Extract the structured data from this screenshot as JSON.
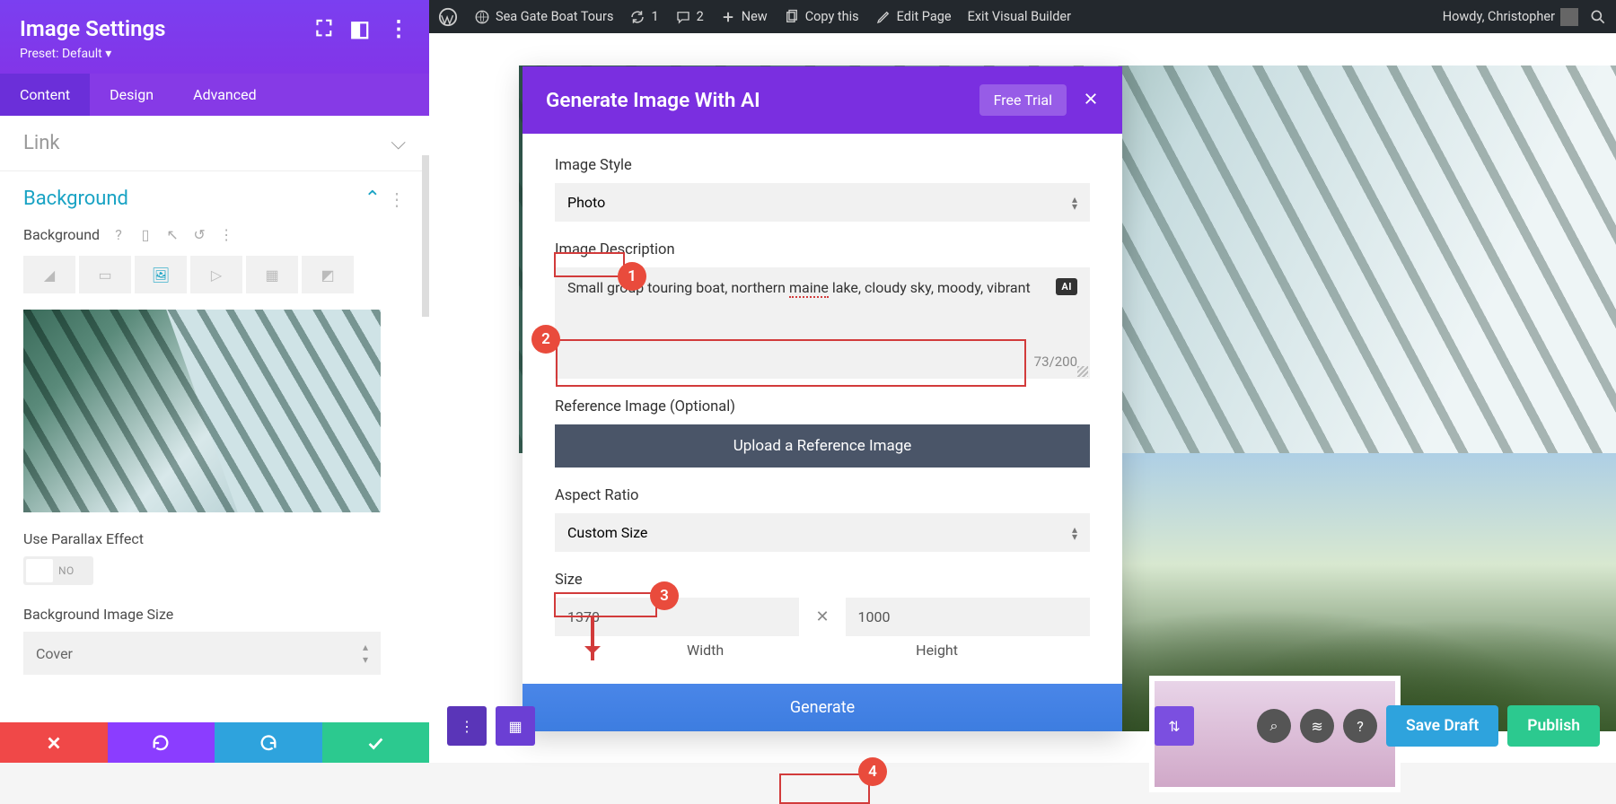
{
  "wp_bar": {
    "site_name": "Sea Gate Boat Tours",
    "updates": "1",
    "comments": "2",
    "new": "New",
    "copy": "Copy this",
    "edit": "Edit Page",
    "exit": "Exit Visual Builder",
    "howdy": "Howdy, Christopher"
  },
  "sidebar": {
    "title": "Image Settings",
    "preset": "Preset: Default",
    "preset_arrow": "▾",
    "tabs": {
      "content": "Content",
      "design": "Design",
      "advanced": "Advanced"
    },
    "link_section": "Link",
    "bg_section": "Background",
    "bg_label": "Background",
    "parallax_label": "Use Parallax Effect",
    "parallax_value": "NO",
    "bg_size_label": "Background Image Size",
    "bg_size_value": "Cover"
  },
  "ai": {
    "title": "Generate Image With AI",
    "trial": "Free Trial",
    "style_label": "Image Style",
    "style_value": "Photo",
    "desc_label": "Image Description",
    "desc_pre": "Small group touring boat, northern ",
    "desc_squiggle": "maine",
    "desc_post": " lake, cloudy sky, moody, vibrant",
    "ai_chip": "AI",
    "counter": "73/200",
    "ref_label": "Reference Image (Optional)",
    "upload": "Upload a Reference Image",
    "ratio_label": "Aspect Ratio",
    "ratio_value": "Custom Size",
    "size_label": "Size",
    "width": "1370",
    "height": "1000",
    "width_label": "Width",
    "height_label": "Height",
    "generate": "Generate"
  },
  "bottom": {
    "save": "Save Draft",
    "publish": "Publish"
  },
  "badges": {
    "b1": "1",
    "b2": "2",
    "b3": "3",
    "b4": "4"
  }
}
